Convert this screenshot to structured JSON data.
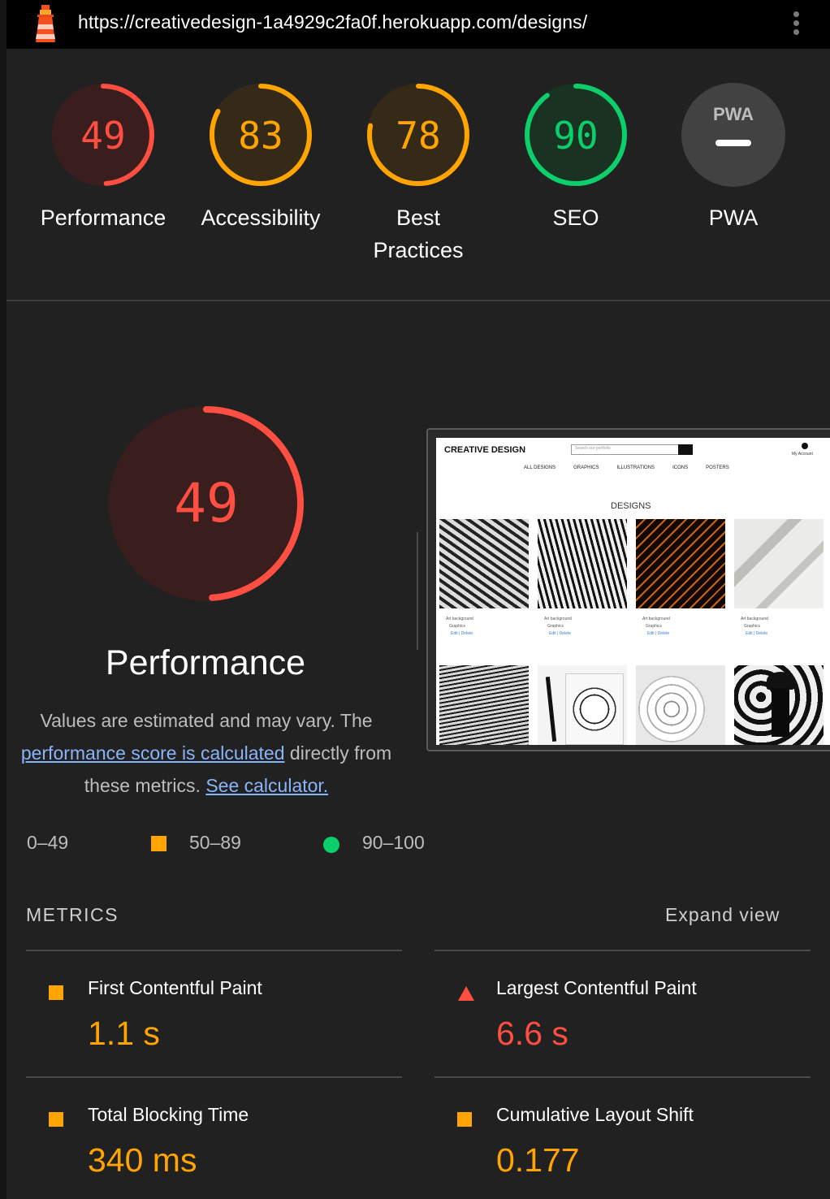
{
  "browser": {
    "url": "https://creativedesign-1a4929c2fa0f.herokuapp.com/designs/"
  },
  "categories": [
    {
      "label": "Performance",
      "score": "49",
      "fraction": 0.49,
      "color": "#ff4e42",
      "bg": "#3a1e1e"
    },
    {
      "label": "Accessibility",
      "score": "83",
      "fraction": 0.83,
      "color": "#ffa400",
      "bg": "#352a18"
    },
    {
      "label": "Best Practices",
      "score": "78",
      "fraction": 0.78,
      "color": "#ffa400",
      "bg": "#352a18"
    },
    {
      "label": "SEO",
      "score": "90",
      "fraction": 0.9,
      "color": "#0cce6b",
      "bg": "#1a3222"
    },
    {
      "label": "PWA",
      "badge": "PWA",
      "color": "#bdbdbd",
      "bg": "#424242"
    }
  ],
  "performance": {
    "score": "49",
    "fraction": 0.49,
    "title": "Performance",
    "desc_part1": "Values are estimated and may vary. The ",
    "desc_link1": "performance score is calculated",
    "desc_part2": " directly from these metrics. ",
    "desc_link2": "See calculator."
  },
  "legend": {
    "fail": "0–49",
    "average": "50–89",
    "pass": "90–100"
  },
  "screenshot": {
    "brand": "CREATIVE DESIGN",
    "search_placeholder": "Search our portfolio",
    "account_label": "My Account",
    "nav": [
      "ALL DESIGNS",
      "GRAPHICS",
      "ILLUSTRATIONS",
      "ICONS",
      "POSTERS"
    ],
    "heading": "DESIGNS",
    "cards": [
      {
        "title": "Art background",
        "category": "Graphics",
        "actions": "Edit | Delete"
      },
      {
        "title": "Art background",
        "category": "Graphics",
        "actions": "Edit | Delete"
      },
      {
        "title": "Art background",
        "category": "Graphics",
        "actions": "Edit | Delete"
      },
      {
        "title": "Art background",
        "category": "Graphics",
        "actions": "Edit | Delete"
      }
    ]
  },
  "metrics": {
    "title": "METRICS",
    "expand": "Expand view",
    "items": [
      {
        "label": "First Contentful Paint",
        "value": "1.1 s",
        "status": "average"
      },
      {
        "label": "Largest Contentful Paint",
        "value": "6.6 s",
        "status": "fail"
      },
      {
        "label": "Total Blocking Time",
        "value": "340 ms",
        "status": "average"
      },
      {
        "label": "Cumulative Layout Shift",
        "value": "0.177",
        "status": "average"
      }
    ]
  },
  "colors": {
    "fail": "#ff4e42",
    "average": "#ffa400",
    "pass": "#0cce6b",
    "link": "#8ab4f8"
  }
}
